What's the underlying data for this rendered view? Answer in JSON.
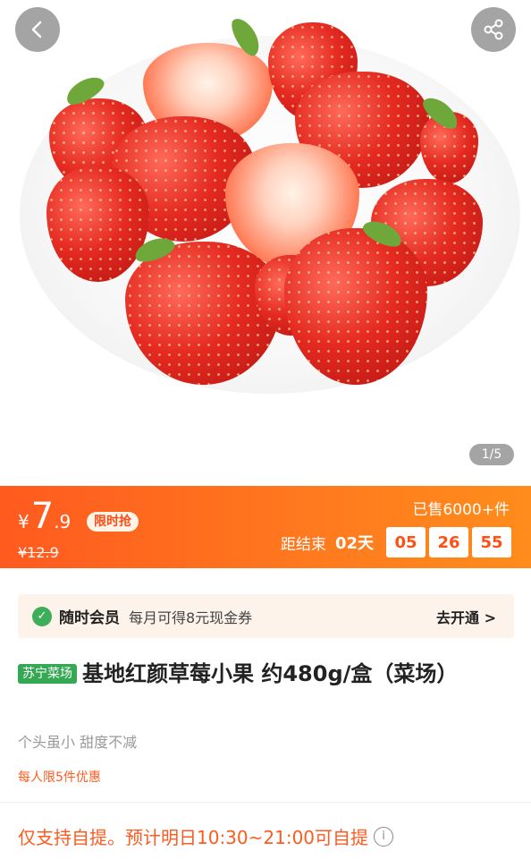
{
  "gallery": {
    "counter": "1/5"
  },
  "price": {
    "currency": "¥",
    "integer": "7",
    "decimal": ".9",
    "flash_label": "限时抢",
    "original": "¥12.9",
    "sold": "已售6000+件",
    "countdown": {
      "label": "距结束",
      "days": "02天",
      "hours": "05",
      "minutes": "26",
      "seconds": "55"
    }
  },
  "member": {
    "title": "随时会员",
    "desc": "每月可得8元现金券",
    "cta": "去开通 >"
  },
  "product": {
    "tag": "苏宁菜场",
    "title": "基地红颜草莓小果 约480g/盒（菜场）",
    "subtitle": "个头虽小 甜度不减",
    "limit": "每人限5件优惠",
    "pickup": "仅支持自提。预计明日10:30~21:00可自提"
  },
  "colors": {
    "accent": "#ff5a1f",
    "member_bg": "#fdf3ea",
    "tag_green": "#34a853"
  }
}
